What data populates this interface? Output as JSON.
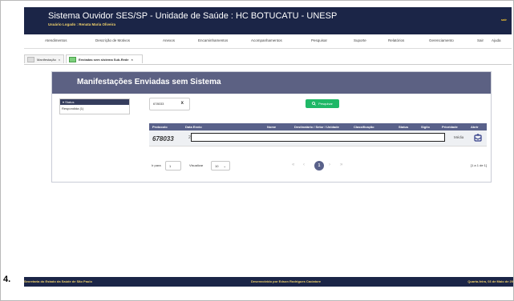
{
  "header": {
    "app_title": "Sistema Ouvidor SES/SP - Unidade de Saúde : HC BOTUCATU - UNESP",
    "logged_user": "Usuário Logado : Renata Maria Oliveira",
    "badge": "sair"
  },
  "nav": {
    "items": [
      {
        "label": "Atendimentos"
      },
      {
        "label": "Descrição de Motivos"
      },
      {
        "label": "Anexos"
      },
      {
        "label": "Encaminhamentos"
      },
      {
        "label": "Acompanhamentos"
      },
      {
        "label": "Pesquisar"
      },
      {
        "label": "Suporte"
      },
      {
        "label": "Relatórios"
      },
      {
        "label": "Gerenciamento"
      },
      {
        "label": "Sair"
      },
      {
        "label": "Ajuda"
      }
    ]
  },
  "tabs": [
    {
      "label": "Manifestação"
    },
    {
      "label": "Enviadas sem sistema Sub-Rede"
    }
  ],
  "colors": {
    "header_bg": "#1b2547",
    "panel_header": "#5c6183",
    "search_button": "#1fb867",
    "accent_yellow": "#f2d36b"
  },
  "panel": {
    "title": "Manifestações Enviadas sem Sistema",
    "status_filter": {
      "label": "Status",
      "items": [
        "Respondida (1)"
      ]
    },
    "search": {
      "value": "678033",
      "clear": "x",
      "button_label": "Pesquisar",
      "button_icon": "search-icon"
    },
    "table": {
      "columns": [
        "Protocolo",
        "Data Envio",
        "Nome",
        "Destinatário / Setor / Unidade",
        "Classificação",
        "Status",
        "Sigilo",
        "Prioridade",
        "Abrir"
      ],
      "rows": [
        {
          "protocolo": "678033",
          "data_envio": "28",
          "prioridade": "Média",
          "abrir_icon": "open-mailbox-icon"
        }
      ]
    },
    "pagination": {
      "go_to_label": "Ir para",
      "page_input": "1",
      "view_label": "Visualizar",
      "page_size": "10",
      "current_page": "1",
      "arrows": [
        "«",
        "‹",
        "›",
        "»"
      ],
      "summary": "[1 a 1 de 1]"
    }
  },
  "footer": {
    "left": "Secretaria do Estado da Saúde de São Paulo",
    "center": "Desenvolvido por Edson Rodrigues Caciatore",
    "right": "Quarta-feira, 03 de Maio de 20"
  },
  "step_number": "4."
}
